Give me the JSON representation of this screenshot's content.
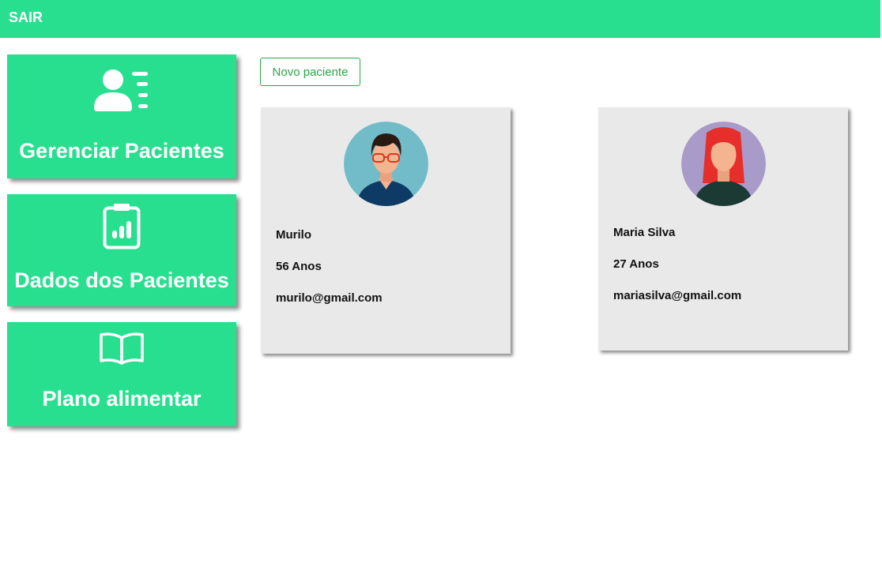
{
  "header": {
    "logout_label": "SAIR",
    "bg_color": "#27df8f"
  },
  "sidebar": {
    "tiles": [
      {
        "label": "Gerenciar Pacientes",
        "icon": "user-list-icon"
      },
      {
        "label": "Dados dos Pacientes",
        "icon": "clipboard-chart-icon"
      },
      {
        "label": "Plano alimentar",
        "icon": "open-book-icon"
      }
    ]
  },
  "main": {
    "new_patient_label": "Novo paciente",
    "patients": [
      {
        "name": "Murilo",
        "age": "56 Anos",
        "email": "murilo@gmail.com",
        "avatar": "male-avatar-icon"
      },
      {
        "name": "Maria Silva",
        "age": "27 Anos",
        "email": "mariasilva@gmail.com",
        "avatar": "female-avatar-icon"
      }
    ]
  }
}
